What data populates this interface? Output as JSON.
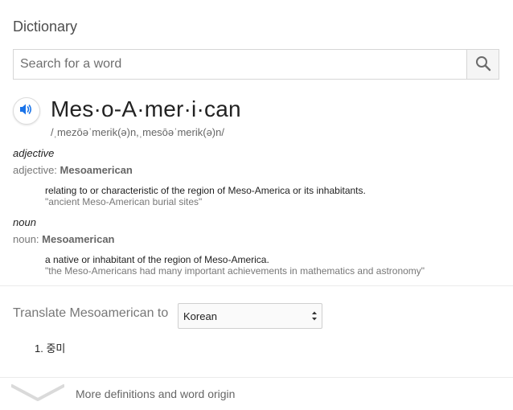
{
  "header": {
    "title": "Dictionary"
  },
  "search": {
    "placeholder": "Search for a word",
    "value": ""
  },
  "entry": {
    "headword": "Mes·o-A·mer·i·can",
    "phonetic": "/ˌmezōəˈmerik(ə)n,ˌmesōəˈmerik(ə)n/",
    "senses": [
      {
        "pos_italic": "adjective",
        "pos_label": "adjective:",
        "pos_word": "Mesoamerican",
        "definition": "relating to or characteristic of the region of Meso-America or its inhabitants.",
        "example": "\"ancient Meso-American burial sites\""
      },
      {
        "pos_italic": "noun",
        "pos_label": "noun:",
        "pos_word": "Mesoamerican",
        "definition": "a native or inhabitant of the region of Meso-America.",
        "example": "\"the Meso-Americans had many important achievements in mathematics and astronomy\""
      }
    ]
  },
  "translate": {
    "label": "Translate Mesoamerican to",
    "selected_language": "Korean",
    "results": [
      {
        "number": "1.",
        "text": "중미"
      }
    ]
  },
  "footer": {
    "more_label": "More definitions and word origin"
  },
  "icons": {
    "search": "search-icon",
    "speaker": "speaker-icon",
    "chevron": "chevron-down-icon",
    "select_arrows": "select-arrows-icon"
  },
  "colors": {
    "speaker_blue": "#1a73e8",
    "search_icon": "#6b6b6b",
    "divider": "#ebebeb"
  }
}
